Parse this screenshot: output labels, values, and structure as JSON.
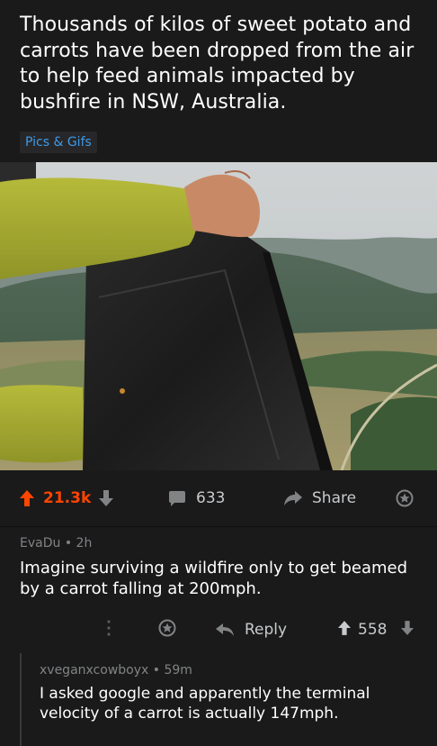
{
  "post": {
    "title": "Thousands of kilos of sweet potato and carrots have been dropped from the air to help feed animals impacted by bushfire in NSW, Australia.",
    "flair": "Pics & Gifs"
  },
  "actions": {
    "score": "21.3k",
    "comments": "633",
    "share": "Share"
  },
  "comments": [
    {
      "author": "EvaDu",
      "age": "2h",
      "body": "Imagine surviving a wildfire only to get beamed by a carrot falling at 200mph.",
      "reply_label": "Reply",
      "score": "558"
    },
    {
      "author": "xveganxcowboyx",
      "age": "59m",
      "body": "I asked google and apparently the terminal velocity of a carrot is actually 147mph."
    }
  ],
  "colors": {
    "background": "#1a1a1b",
    "upvote": "#ff4500",
    "flair_text": "#3d9ae8",
    "muted": "#818384"
  }
}
